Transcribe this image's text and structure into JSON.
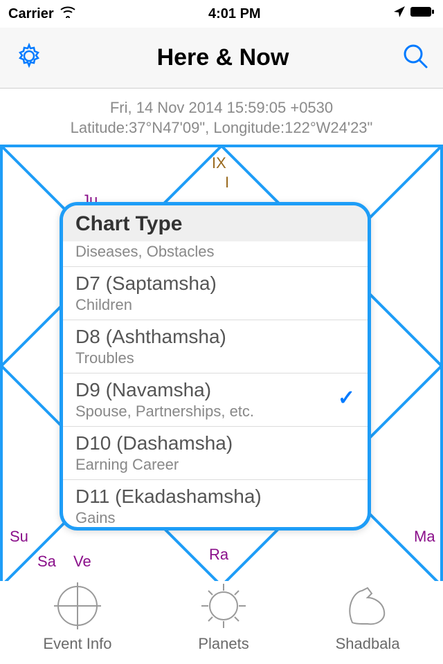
{
  "status": {
    "carrier": "Carrier",
    "time": "4:01 PM"
  },
  "nav": {
    "title": "Here & Now"
  },
  "info": {
    "line1": "Fri, 14 Nov 2014 15:59:05 +0530",
    "line2": "Latitude:37°N47'09\", Longitude:122°W24'23\""
  },
  "chart_labels": {
    "top_ix": "IX",
    "top_i": "I",
    "ju": "Ju",
    "su": "Su",
    "sa": "Sa",
    "ve": "Ve",
    "ra": "Ra",
    "ma": "Ma"
  },
  "popup": {
    "title": "Chart Type",
    "truncated_sub": "Diseases, Obstacles",
    "items": [
      {
        "title": "D7 (Saptamsha)",
        "sub": "Children",
        "selected": false
      },
      {
        "title": "D8 (Ashthamsha)",
        "sub": "Troubles",
        "selected": false
      },
      {
        "title": "D9 (Navamsha)",
        "sub": "Spouse, Partnerships, etc.",
        "selected": true
      },
      {
        "title": "D10 (Dashamsha)",
        "sub": "Earning Career",
        "selected": false
      },
      {
        "title": "D11 (Ekadashamsha)",
        "sub": "Gains",
        "selected": false
      }
    ]
  },
  "tabs": {
    "event": "Event Info",
    "planets": "Planets",
    "shadbala": "Shadbala"
  }
}
